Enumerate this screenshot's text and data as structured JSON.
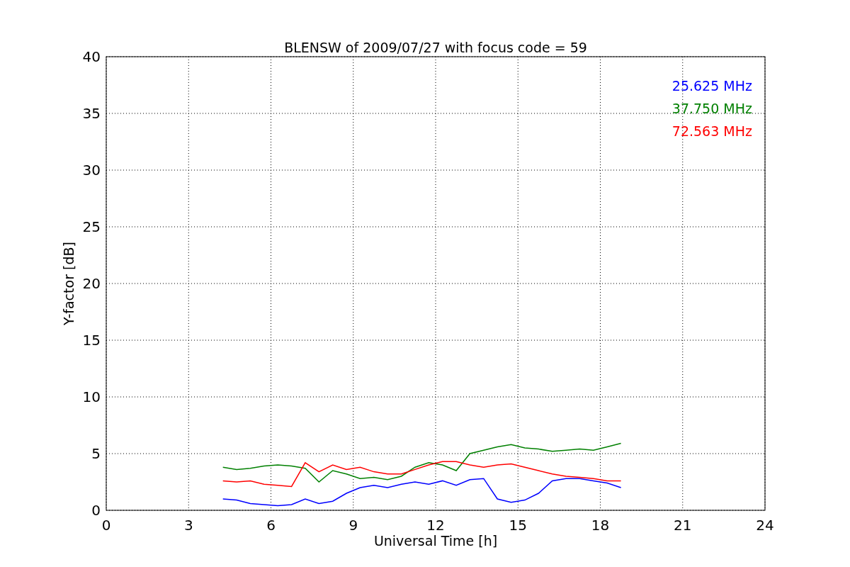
{
  "figure": {
    "chart_data": {
      "type": "line",
      "title": "BLENSW of 2009/07/27 with focus code = 59",
      "xlabel": "Universal Time [h]",
      "ylabel": "Y-factor [dB]",
      "x": [
        4.25,
        4.75,
        5.25,
        5.75,
        6.25,
        6.75,
        7.25,
        7.75,
        8.25,
        8.75,
        9.25,
        9.75,
        10.25,
        10.75,
        11.25,
        11.75,
        12.25,
        12.75,
        13.25,
        13.75,
        14.25,
        14.75,
        15.25,
        15.75,
        16.25,
        16.75,
        17.25,
        17.75,
        18.25,
        18.75
      ],
      "series": [
        {
          "name": "25.625 MHz",
          "color": "#0000ff",
          "values": [
            1.0,
            0.9,
            0.6,
            0.5,
            0.4,
            0.5,
            1.0,
            0.6,
            0.8,
            1.5,
            2.0,
            2.2,
            2.0,
            2.3,
            2.5,
            2.3,
            2.6,
            2.2,
            2.7,
            2.8,
            1.0,
            0.7,
            0.9,
            1.5,
            2.6,
            2.8,
            2.8,
            2.6,
            2.4,
            2.0
          ]
        },
        {
          "name": "37.750 MHz",
          "color": "#008000",
          "values": [
            3.8,
            3.6,
            3.7,
            3.9,
            4.0,
            3.9,
            3.7,
            2.5,
            3.5,
            3.2,
            2.8,
            2.9,
            2.7,
            3.0,
            3.8,
            4.2,
            4.0,
            3.5,
            5.0,
            5.3,
            5.6,
            5.8,
            5.5,
            5.4,
            5.2,
            5.3,
            5.4,
            5.3,
            5.6,
            5.9
          ]
        },
        {
          "name": "72.563 MHz",
          "color": "#ff0000",
          "values": [
            2.6,
            2.5,
            2.6,
            2.3,
            2.2,
            2.1,
            4.2,
            3.4,
            4.0,
            3.6,
            3.8,
            3.4,
            3.2,
            3.2,
            3.6,
            4.0,
            4.3,
            4.3,
            4.0,
            3.8,
            4.0,
            4.1,
            3.8,
            3.5,
            3.2,
            3.0,
            2.9,
            2.8,
            2.6,
            2.6
          ]
        }
      ],
      "xlim": [
        0,
        24
      ],
      "ylim": [
        0,
        40
      ],
      "xticks": [
        0,
        3,
        6,
        9,
        12,
        15,
        18,
        21,
        24
      ],
      "yticks": [
        0,
        5,
        10,
        15,
        20,
        25,
        30,
        35,
        40
      ],
      "grid": true
    }
  }
}
